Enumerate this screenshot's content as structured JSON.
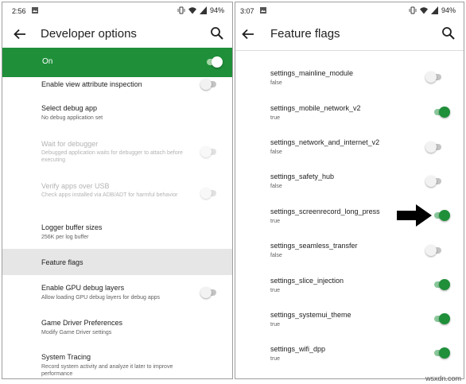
{
  "left": {
    "status": {
      "time": "2:56",
      "battery": "94%"
    },
    "title": "Developer options",
    "master": {
      "label": "On",
      "state": "on"
    },
    "items": [
      {
        "title": "Enable view attribute inspection",
        "subtitle": "",
        "toggle": "off",
        "disabled": false
      },
      {
        "title": "Select debug app",
        "subtitle": "No debug application set",
        "toggle": null,
        "disabled": false
      },
      {
        "title": "Wait for debugger",
        "subtitle": "Debugged application waits for debugger to attach before executing",
        "toggle": "off",
        "disabled": true
      },
      {
        "title": "Verify apps over USB",
        "subtitle": "Check apps installed via ADB/ADT for harmful behavior",
        "toggle": "off",
        "disabled": true
      },
      {
        "title": "Logger buffer sizes",
        "subtitle": "256K per log buffer",
        "toggle": null,
        "disabled": false
      },
      {
        "title": "Feature flags",
        "subtitle": "",
        "toggle": null,
        "disabled": false,
        "highlighted": true
      },
      {
        "title": "Enable GPU debug layers",
        "subtitle": "Allow loading GPU debug layers for debug apps",
        "toggle": "off",
        "disabled": false
      },
      {
        "title": "Game Driver Preferences",
        "subtitle": "Modify Game Driver settings",
        "toggle": null,
        "disabled": false
      },
      {
        "title": "System Tracing",
        "subtitle": "Record system activity and analyze it later to improve performance",
        "toggle": null,
        "disabled": false
      }
    ]
  },
  "right": {
    "status": {
      "time": "3:07",
      "battery": "94%"
    },
    "title": "Feature flags",
    "flags": [
      {
        "name": "settings_mainline_module",
        "value": "false"
      },
      {
        "name": "settings_mobile_network_v2",
        "value": "true"
      },
      {
        "name": "settings_network_and_internet_v2",
        "value": "false"
      },
      {
        "name": "settings_safety_hub",
        "value": "false"
      },
      {
        "name": "settings_screenrecord_long_press",
        "value": "true"
      },
      {
        "name": "settings_seamless_transfer",
        "value": "false"
      },
      {
        "name": "settings_slice_injection",
        "value": "true"
      },
      {
        "name": "settings_systemui_theme",
        "value": "true"
      },
      {
        "name": "settings_wifi_dpp",
        "value": "true"
      }
    ]
  },
  "watermark": "wsxdn.com",
  "colors": {
    "accent": "#1f8f3a",
    "highlight": "#e6e6e6"
  }
}
